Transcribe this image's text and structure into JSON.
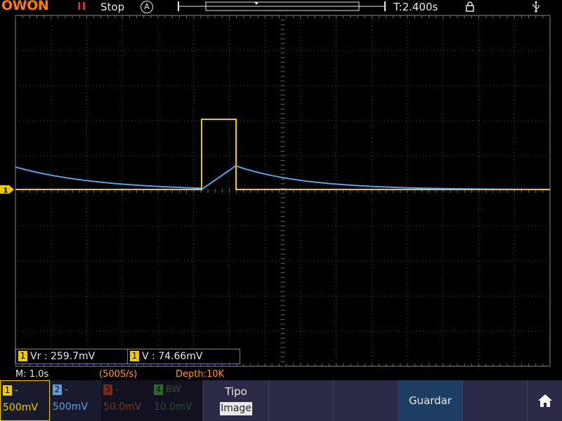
{
  "header": {
    "brand": "OWON",
    "run_status": "Stop",
    "acquire_mode": "A",
    "trigger_time": "T:2.400s"
  },
  "measurements": [
    {
      "channel": "1",
      "text": "Vr : 259.7mV"
    },
    {
      "channel": "1",
      "text": "V : 74.66mV"
    }
  ],
  "status": {
    "timebase": "M: 1.0s",
    "sample_rate": "(500S/s)",
    "depth": "Depth:10K"
  },
  "channels": [
    {
      "number": "1",
      "suffix": "-",
      "scale": "500mV",
      "color": "#f0c800"
    },
    {
      "number": "2",
      "suffix": "-",
      "scale": "500mV",
      "color": "#5aa0e6"
    },
    {
      "number": "3",
      "suffix": "-",
      "scale": "50.0mV",
      "color": "#b04020"
    },
    {
      "number": "4",
      "suffix": "BW",
      "scale": "10.0mV",
      "color": "#3a9a3a"
    }
  ],
  "softkeys": {
    "tipo_label": "Tipo",
    "tipo_value": "Image",
    "guardar_label": "Guardar"
  },
  "trigger_marker": "1",
  "colors": {
    "ch1": "#f0c800",
    "ch2": "#5aa0e6",
    "grid": "#555555",
    "accent": "#ff7a00"
  }
}
